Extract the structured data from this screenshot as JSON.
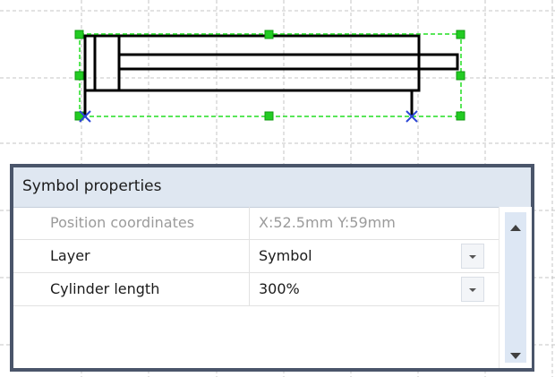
{
  "panel": {
    "title": "Symbol properties",
    "rows": [
      {
        "label": "Position coordinates",
        "value": "X:52.5mm Y:59mm",
        "enabled": false,
        "has_dropdown": false
      },
      {
        "label": "Layer",
        "value": "Symbol",
        "enabled": true,
        "has_dropdown": true
      },
      {
        "label": "Cylinder length",
        "value": "300%",
        "enabled": true,
        "has_dropdown": true
      }
    ]
  },
  "colors": {
    "selection_handle": "#22cc22",
    "selection_outline": "#22dd22",
    "connection_marker": "#2b45d6",
    "panel_border": "#4a556a",
    "panel_header": "#dfe7f1"
  },
  "icons": {
    "scroll_up": "triangle-up",
    "scroll_down": "triangle-down",
    "dropdown": "triangle-down"
  }
}
